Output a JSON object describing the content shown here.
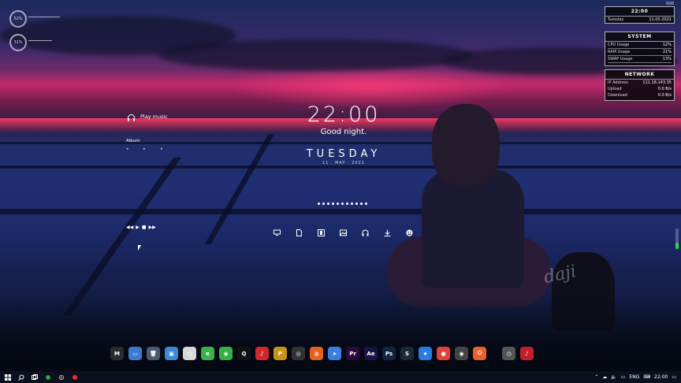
{
  "rings": [
    {
      "value": "52%",
      "caption_top": "",
      "caption_bottom": ""
    },
    {
      "value": "31%",
      "caption_top": "",
      "caption_bottom": ""
    }
  ],
  "clock": {
    "time": "22:00",
    "greeting": "Good night.",
    "day": "TUESDAY",
    "date": "11 . MAY . 2021"
  },
  "music": {
    "play_label": "Play music",
    "album_label": "Album"
  },
  "center_icons": [
    "monitor-icon",
    "document-icon",
    "film-icon",
    "image-icon",
    "headphones-icon",
    "download-icon",
    "emoji-icon"
  ],
  "panels": {
    "clock": {
      "time": "22:00",
      "day": "Tuesday",
      "date": "11.05.2021"
    },
    "system": {
      "title": "SYSTEM",
      "rows": [
        {
          "label": "CPU Usage",
          "value": "12%"
        },
        {
          "label": "RAM Usage",
          "value": "21%"
        },
        {
          "label": "SWAP Usage",
          "value": "13%"
        }
      ]
    },
    "network": {
      "title": "NETWORK",
      "rows": [
        {
          "label": "IP Address",
          "value": "111.18.143.35"
        },
        {
          "label": "Upload",
          "value": "0.0 B/s"
        },
        {
          "label": "Download",
          "value": "0.0 B/s"
        }
      ]
    }
  },
  "dock": [
    {
      "name": "mediaplayer",
      "glyph": "M",
      "color": "#2b2b2b"
    },
    {
      "name": "this-pc",
      "glyph": "▭",
      "color": "#3b7ad0"
    },
    {
      "name": "recycle-bin",
      "glyph": "🗑",
      "color": "#4a5a70"
    },
    {
      "name": "control-panel",
      "glyph": "▣",
      "color": "#3a8ad6"
    },
    {
      "name": "clock",
      "glyph": "◷",
      "color": "#d8d8d8"
    },
    {
      "name": "ie",
      "glyph": "e",
      "color": "#3cb04a"
    },
    {
      "name": "wechat",
      "glyph": "◉",
      "color": "#35b044"
    },
    {
      "name": "qq",
      "glyph": "Q",
      "color": "#111111"
    },
    {
      "name": "netease-music",
      "glyph": "♪",
      "color": "#d0282c"
    },
    {
      "name": "pubg",
      "glyph": "P",
      "color": "#c6931e"
    },
    {
      "name": "obs",
      "glyph": "◎",
      "color": "#333333"
    },
    {
      "name": "firefox",
      "glyph": "◍",
      "color": "#e2621f"
    },
    {
      "name": "feishu",
      "glyph": "➤",
      "color": "#3a7fe0"
    },
    {
      "name": "premiere",
      "glyph": "Pr",
      "color": "#2a0a3c"
    },
    {
      "name": "after-effects",
      "glyph": "Ae",
      "color": "#1b1245"
    },
    {
      "name": "photoshop",
      "glyph": "Ps",
      "color": "#0f2440"
    },
    {
      "name": "steam",
      "glyph": "S",
      "color": "#1b2838"
    },
    {
      "name": "star-app",
      "glyph": "★",
      "color": "#2a7ae0"
    },
    {
      "name": "record-app",
      "glyph": "●",
      "color": "#e5403a"
    },
    {
      "name": "camera-app",
      "glyph": "◉",
      "color": "#444444"
    },
    {
      "name": "power",
      "glyph": "⏻",
      "color": "#e8602a"
    },
    {
      "name": "monitor-clock",
      "glyph": "◷",
      "color": "#555555"
    },
    {
      "name": "netease-mini",
      "glyph": "♪",
      "color": "#c21f2a"
    }
  ],
  "taskbar": {
    "left_icons": [
      "windows-icon",
      "search-icon",
      "taskview-icon",
      "wechat-icon",
      "obs-icon",
      "netease-icon"
    ],
    "lang": "ENG",
    "time": "22:00"
  }
}
